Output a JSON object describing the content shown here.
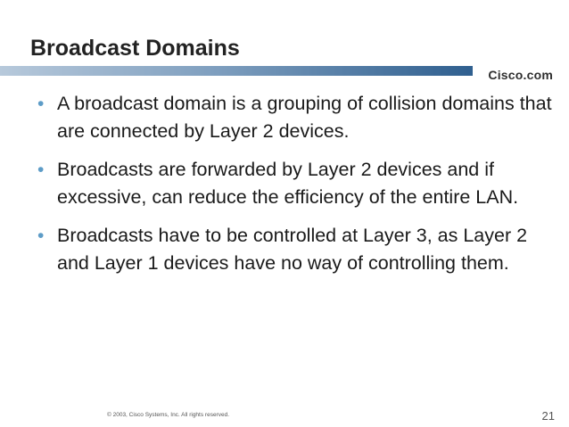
{
  "slide": {
    "title": "Broadcast Domains",
    "brand": "Cisco.com",
    "bullets": [
      "A broadcast domain is a grouping of collision domains that are connected by Layer 2 devices.",
      "Broadcasts are forwarded by Layer 2 devices and if excessive, can reduce the efficiency of the entire LAN.",
      "Broadcasts have to be controlled at Layer 3, as Layer 2 and Layer 1 devices have no way of controlling them."
    ],
    "bullet_glyph": "•",
    "copyright": "© 2003, Cisco Systems, Inc. All rights reserved.",
    "page_number": "21"
  },
  "colors": {
    "header_bar_start": "#9fb7cf",
    "header_bar_end": "#2f5f8f",
    "bullet": "#5d9cc7"
  },
  "icons": {
    "header_bar": "gradient-bar"
  }
}
